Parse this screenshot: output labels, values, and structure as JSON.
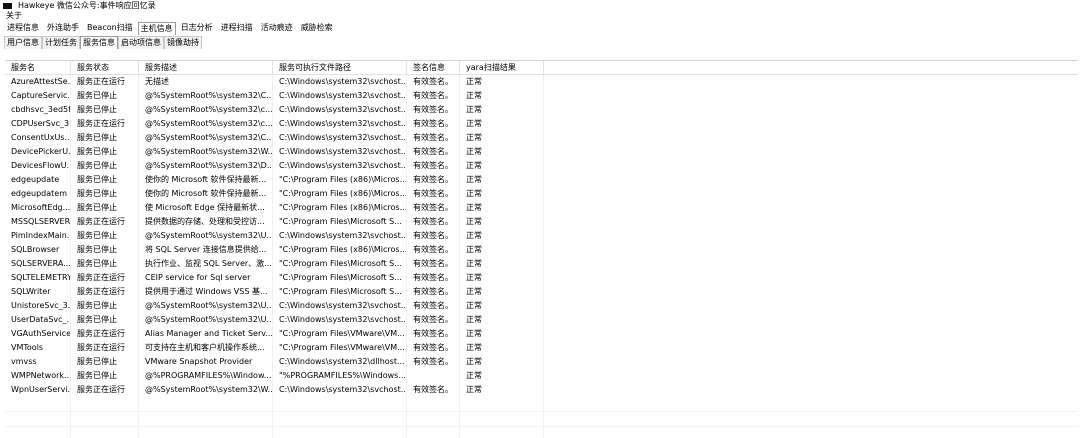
{
  "window": {
    "title": "Hawkeye 微信公众号:事件响应回忆录"
  },
  "menu": {
    "about": "关于"
  },
  "main_tabs": [
    {
      "label": "进程信息",
      "active": false
    },
    {
      "label": "外连助手",
      "active": false
    },
    {
      "label": "Beacon扫描",
      "active": false
    },
    {
      "label": "主机信息",
      "active": true
    },
    {
      "label": "日志分析",
      "active": false
    },
    {
      "label": "进程扫描",
      "active": false
    },
    {
      "label": "活动痕迹",
      "active": false
    },
    {
      "label": "威胁检索",
      "active": false
    }
  ],
  "sub_tabs": [
    {
      "label": "用户信息",
      "active": false
    },
    {
      "label": "计划任务",
      "active": false
    },
    {
      "label": "服务信息",
      "active": true
    },
    {
      "label": "启动项信息",
      "active": false
    },
    {
      "label": "镜像劫持",
      "active": false
    }
  ],
  "table": {
    "columns": [
      "服务名",
      "服务状态",
      "服务描述",
      "服务可执行文件路径",
      "签名信息",
      "yara扫描结果",
      ""
    ],
    "rows": [
      [
        "AzureAttestSe...",
        "服务正在运行",
        "无描述",
        "C:\\Windows\\system32\\svchost...",
        "有效签名。",
        "正常"
      ],
      [
        "CaptureServic...",
        "服务已停止",
        "@%SystemRoot%\\system32\\C...",
        "C:\\Windows\\system32\\svchost...",
        "有效签名。",
        "正常"
      ],
      [
        "cbdhsvc_3ed5f",
        "服务已停止",
        "@%SystemRoot%\\system32\\c...",
        "C:\\Windows\\system32\\svchost...",
        "有效签名。",
        "正常"
      ],
      [
        "CDPUserSvc_3...",
        "服务正在运行",
        "@%SystemRoot%\\system32\\c...",
        "C:\\Windows\\system32\\svchost...",
        "有效签名。",
        "正常"
      ],
      [
        "ConsentUxUs...",
        "服务已停止",
        "@%SystemRoot%\\system32\\C...",
        "C:\\Windows\\system32\\svchost...",
        "有效签名。",
        "正常"
      ],
      [
        "DevicePickerU...",
        "服务已停止",
        "@%SystemRoot%\\system32\\W...",
        "C:\\Windows\\system32\\svchost...",
        "有效签名。",
        "正常"
      ],
      [
        "DevicesFlowU...",
        "服务已停止",
        "@%SystemRoot%\\system32\\D...",
        "C:\\Windows\\system32\\svchost...",
        "有效签名。",
        "正常"
      ],
      [
        "edgeupdate",
        "服务已停止",
        "使你的 Microsoft 软件保持最新...",
        "\"C:\\Program Files (x86)\\Micros...",
        "有效签名。",
        "正常"
      ],
      [
        "edgeupdatem",
        "服务已停止",
        "使你的 Microsoft 软件保持最新...",
        "\"C:\\Program Files (x86)\\Micros...",
        "有效签名。",
        "正常"
      ],
      [
        "MicrosoftEdg...",
        "服务已停止",
        "使 Microsoft Edge 保持最新状...",
        "\"C:\\Program Files (x86)\\Micros...",
        "有效签名。",
        "正常"
      ],
      [
        "MSSQLSERVER",
        "服务正在运行",
        "提供数据的存储、处理和受控访...",
        "\"C:\\Program Files\\Microsoft S...",
        "有效签名。",
        "正常"
      ],
      [
        "PimIndexMain...",
        "服务已停止",
        "@%SystemRoot%\\system32\\U...",
        "C:\\Windows\\system32\\svchost...",
        "有效签名。",
        "正常"
      ],
      [
        "SQLBrowser",
        "服务已停止",
        "将 SQL Server 连接信息提供给...",
        "\"C:\\Program Files (x86)\\Micros...",
        "有效签名。",
        "正常"
      ],
      [
        "SQLSERVERA...",
        "服务已停止",
        "执行作业、监视 SQL Server、激...",
        "\"C:\\Program Files\\Microsoft S...",
        "有效签名。",
        "正常"
      ],
      [
        "SQLTELEMETRY",
        "服务正在运行",
        "CEIP service for Sql server",
        "\"C:\\Program Files\\Microsoft S...",
        "有效签名。",
        "正常"
      ],
      [
        "SQLWriter",
        "服务正在运行",
        "提供用于通过 Windows VSS 基...",
        "\"C:\\Program Files\\Microsoft S...",
        "有效签名。",
        "正常"
      ],
      [
        "UnistoreSvc_3...",
        "服务已停止",
        "@%SystemRoot%\\system32\\U...",
        "C:\\Windows\\system32\\svchost...",
        "有效签名。",
        "正常"
      ],
      [
        "UserDataSvc_...",
        "服务已停止",
        "@%SystemRoot%\\system32\\U...",
        "C:\\Windows\\system32\\svchost...",
        "有效签名。",
        "正常"
      ],
      [
        "VGAuthService",
        "服务正在运行",
        "Alias Manager and Ticket Serv...",
        "\"C:\\Program Files\\VMware\\VM...",
        "有效签名。",
        "正常"
      ],
      [
        "VMTools",
        "服务正在运行",
        "可支持在主机和客户机操作系统...",
        "\"C:\\Program Files\\VMware\\VM...",
        "有效签名。",
        "正常"
      ],
      [
        "vmvss",
        "服务已停止",
        "VMware Snapshot Provider",
        "C:\\Windows\\system32\\dllhost...",
        "有效签名。",
        "正常"
      ],
      [
        "WMPNetwork...",
        "服务已停止",
        "@%PROGRAMFILES%\\Window...",
        "\"%PROGRAMFILES%\\Windows...",
        "",
        "正常"
      ],
      [
        "WpnUserServi...",
        "服务正在运行",
        "@%SystemRoot%\\system32\\W...",
        "C:\\Windows\\system32\\svchost...",
        "有效签名。",
        "正常"
      ]
    ]
  }
}
